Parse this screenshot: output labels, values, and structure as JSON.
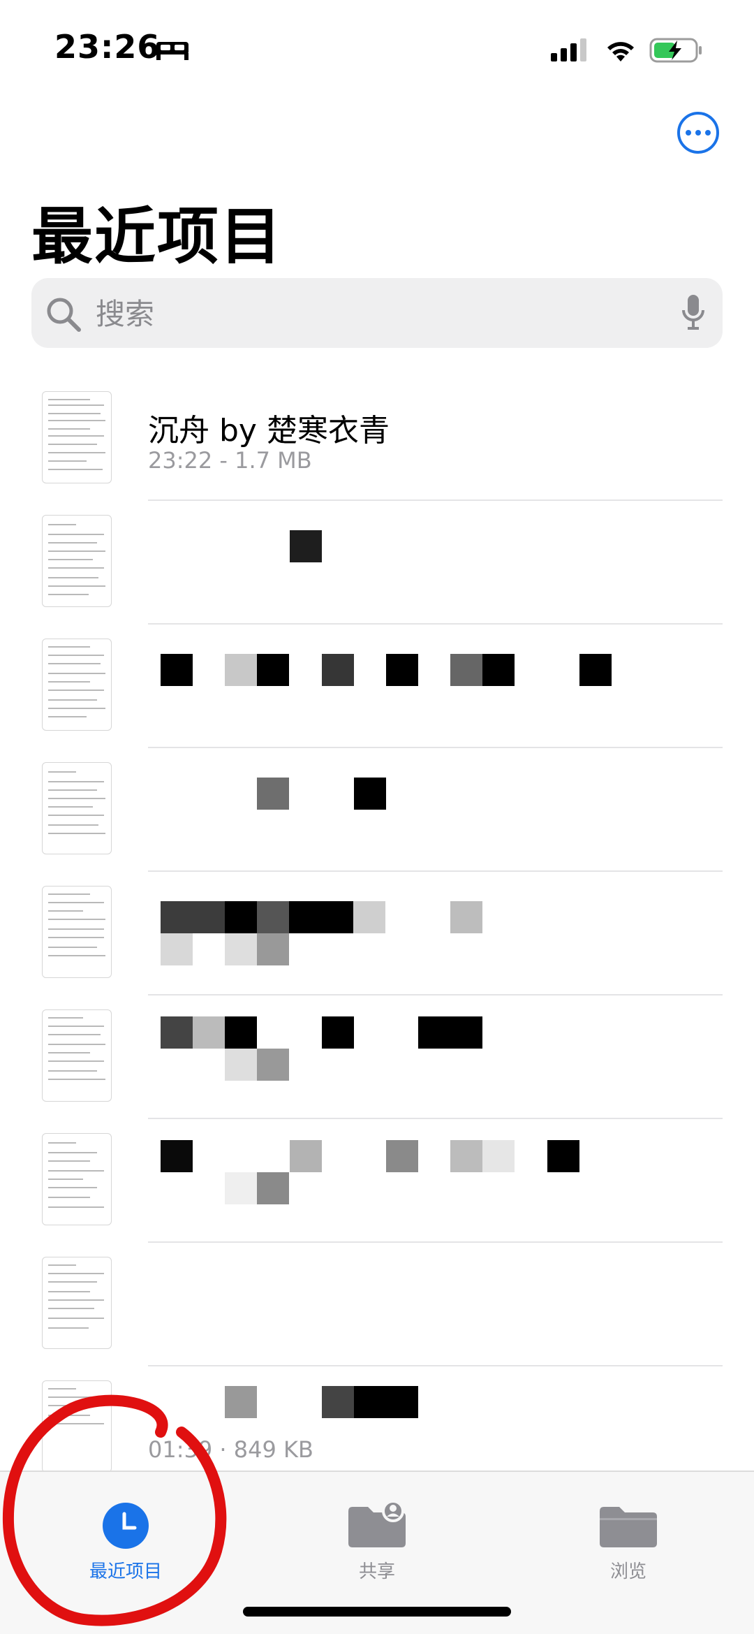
{
  "status_bar": {
    "time": "23:26"
  },
  "header": {
    "title": "最近项目",
    "more_icon": "ellipsis-circle-icon"
  },
  "search": {
    "placeholder": "搜索"
  },
  "files": [
    {
      "name": "沉舟 by 楚寒衣青",
      "meta": "23:22 - 1.7 MB"
    },
    {
      "name": "",
      "meta": ""
    },
    {
      "name": "",
      "meta": ""
    },
    {
      "name": "",
      "meta": ""
    },
    {
      "name": "",
      "meta": ""
    },
    {
      "name": "",
      "meta": ""
    },
    {
      "name": "",
      "meta": ""
    },
    {
      "name": "",
      "meta": ""
    },
    {
      "name": "",
      "meta": "01:39 · 849 KB"
    }
  ],
  "tabs": [
    {
      "label": "最近项目",
      "active": true,
      "icon": "clock-icon"
    },
    {
      "label": "共享",
      "active": false,
      "icon": "shared-folder-icon"
    },
    {
      "label": "浏览",
      "active": false,
      "icon": "folder-icon"
    }
  ],
  "colors": {
    "accent": "#1a73e8",
    "inactive": "#8e8e93",
    "annotation": "#e01010"
  }
}
